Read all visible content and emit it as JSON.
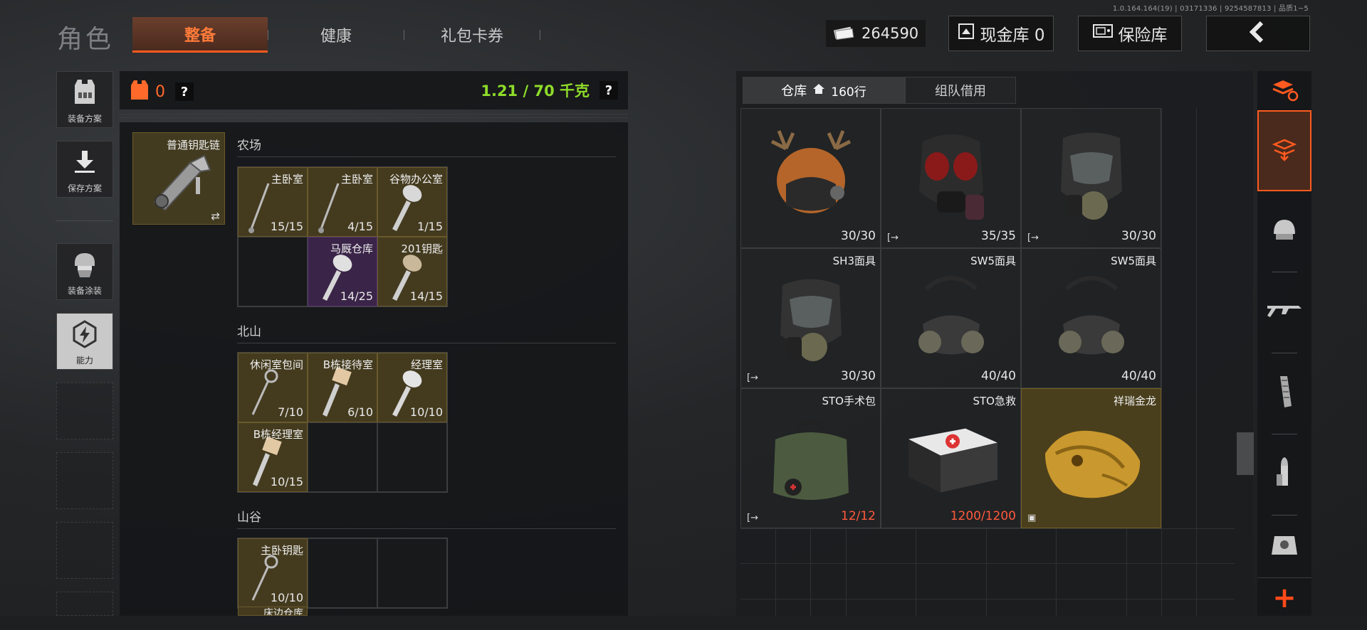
{
  "version": "1.0.164.164(19) | 03171336 | 9254587813 | 品质1~5",
  "page_title": "角色",
  "tabs": [
    {
      "label": "整备",
      "active": true
    },
    {
      "label": "健康",
      "active": false
    },
    {
      "label": "礼包卡券",
      "active": false
    }
  ],
  "currency": {
    "icon": "cash-icon",
    "amount": "264590"
  },
  "cash_vault": {
    "label": "现金库 0",
    "icon": "vault-icon"
  },
  "safe_box": {
    "label": "保险库",
    "icon": "safe-icon"
  },
  "sidebar": [
    {
      "label": "装备方案",
      "icon": "armor-vest-icon"
    },
    {
      "label": "保存方案",
      "icon": "download-icon"
    },
    {
      "label": "装备涂装",
      "icon": "soldier-helmet-icon"
    },
    {
      "label": "能力",
      "icon": "ability-bolt-icon",
      "active": true
    }
  ],
  "equipment": {
    "armor_count": "0",
    "help": "?",
    "weight": "1.21 / 70 千克",
    "weight_color": "#8fdc2a"
  },
  "keychain": {
    "name": "普通钥匙链",
    "swap_icon": "⇄"
  },
  "key_sections": [
    {
      "title": "农场",
      "keys": [
        {
          "name": "主卧室",
          "count": "15/15",
          "rarity": "gold",
          "icon": "thin-key-icon"
        },
        {
          "name": "主卧室",
          "count": "4/15",
          "rarity": "gold",
          "icon": "thin-key-icon"
        },
        {
          "name": "谷物办公室",
          "count": "1/15",
          "rarity": "gold",
          "icon": "key-icon"
        },
        {
          "name": "",
          "count": "",
          "rarity": "empty",
          "icon": ""
        },
        {
          "name": "马厩仓库",
          "count": "14/25",
          "rarity": "purple",
          "icon": "key-icon"
        },
        {
          "name": "201钥匙",
          "count": "14/15",
          "rarity": "gold",
          "icon": "key-icon"
        }
      ]
    },
    {
      "title": "北山",
      "keys": [
        {
          "name": "休闲室包间",
          "count": "7/10",
          "rarity": "gold",
          "icon": "thin-key-icon"
        },
        {
          "name": "B栋接待室",
          "count": "6/10",
          "rarity": "gold",
          "icon": "tagged-key-icon"
        },
        {
          "name": "经理室",
          "count": "10/10",
          "rarity": "gold",
          "icon": "key-icon"
        },
        {
          "name": "B栋经理室",
          "count": "10/15",
          "rarity": "gold",
          "icon": "tagged-key-icon"
        },
        {
          "name": "",
          "count": "",
          "rarity": "empty",
          "icon": ""
        },
        {
          "name": "",
          "count": "",
          "rarity": "empty",
          "icon": ""
        }
      ]
    },
    {
      "title": "山谷",
      "keys": [
        {
          "name": "主卧钥匙",
          "count": "10/10",
          "rarity": "gold",
          "icon": "thin-key-icon"
        },
        {
          "name": "",
          "count": "",
          "rarity": "empty",
          "icon": ""
        },
        {
          "name": "",
          "count": "",
          "rarity": "empty",
          "icon": ""
        },
        {
          "name": "床边仓库",
          "count": "",
          "rarity": "gold",
          "icon": ""
        }
      ]
    }
  ],
  "warehouse": {
    "tabs": [
      {
        "label": "仓库",
        "extra": "160行",
        "icon": "home-icon",
        "active": true
      },
      {
        "label": "组队借用",
        "extra": "",
        "icon": "",
        "active": false
      }
    ],
    "items": [
      {
        "name": "",
        "count": "30/30",
        "tag": "",
        "rarity": "normal",
        "icon": "antler-helmet-icon",
        "count_color": "normal"
      },
      {
        "name": "",
        "count": "35/35",
        "tag": "[→",
        "rarity": "normal",
        "icon": "gas-mask-red-icon",
        "count_color": "normal"
      },
      {
        "name": "",
        "count": "30/30",
        "tag": "[→",
        "rarity": "normal",
        "icon": "gas-mask-icon",
        "count_color": "normal"
      },
      {
        "name": "SH3面具",
        "count": "30/30",
        "tag": "[→",
        "rarity": "normal",
        "icon": "gas-mask-icon",
        "count_color": "normal"
      },
      {
        "name": "SW5面具",
        "count": "40/40",
        "tag": "",
        "rarity": "normal",
        "icon": "half-mask-icon",
        "count_color": "normal"
      },
      {
        "name": "SW5面具",
        "count": "40/40",
        "tag": "",
        "rarity": "normal",
        "icon": "half-mask-icon",
        "count_color": "normal"
      },
      {
        "name": "STO手术包",
        "count": "12/12",
        "tag": "[→",
        "rarity": "normal",
        "icon": "surgery-bag-icon",
        "count_color": "red"
      },
      {
        "name": "STO急救",
        "count": "1200/1200",
        "tag": "",
        "rarity": "normal",
        "icon": "first-aid-case-icon",
        "count_color": "red"
      },
      {
        "name": "祥瑞金龙",
        "count": "",
        "tag": "▣",
        "rarity": "gold",
        "icon": "golden-dragon-icon",
        "count_color": "normal"
      }
    ]
  },
  "categories": [
    {
      "icon": "layers-refresh-icon",
      "active": false
    },
    {
      "icon": "layers-down-icon",
      "active": true
    },
    {
      "icon": "helmet-icon",
      "active": false
    },
    {
      "icon": "rifle-icon",
      "active": false
    },
    {
      "icon": "magazine-icon",
      "active": false
    },
    {
      "icon": "bullet-icon",
      "active": false
    },
    {
      "icon": "sight-icon",
      "active": false
    }
  ],
  "add_button": "+",
  "colors": {
    "accent": "#ff5a1f",
    "gold_rarity": "#443b1f",
    "purple_rarity": "#3a2448",
    "low_count": "#ff5a3c"
  }
}
